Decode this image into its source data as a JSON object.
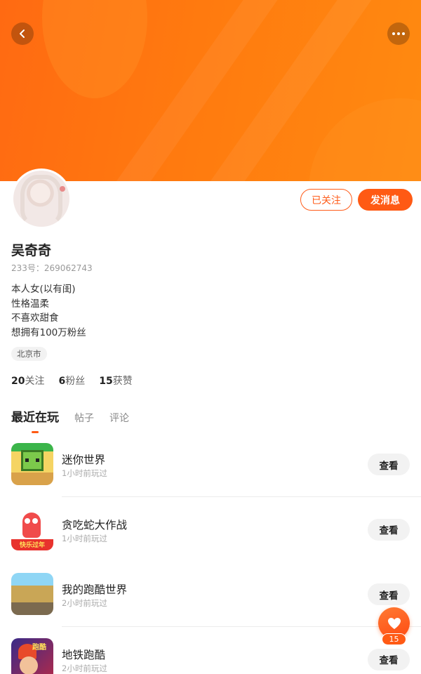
{
  "header": {
    "back_icon": "chevron-left-icon",
    "more_icon": "more-horizontal-icon",
    "cover_color": "#ff6a12"
  },
  "profile": {
    "name": "吴奇奇",
    "uid": "233号：269062743",
    "bio": [
      "本人女(以有闺)",
      "性格温柔",
      "不喜欢甜食",
      "想拥有100万粉丝"
    ],
    "location": "北京市",
    "stats": [
      {
        "value": "20",
        "label": "关注"
      },
      {
        "value": "6",
        "label": "粉丝"
      },
      {
        "value": "15",
        "label": "获赞"
      }
    ]
  },
  "actions": {
    "follow_label": "已关注",
    "message_label": "发消息",
    "accent_color": "#ff5a14"
  },
  "tabs": [
    {
      "label": "最近在玩",
      "active": true
    },
    {
      "label": "帖子",
      "active": false
    },
    {
      "label": "评论",
      "active": false
    }
  ],
  "games": [
    {
      "title": "迷你世界",
      "time": "1小时前玩过",
      "button": "查看"
    },
    {
      "title": "贪吃蛇大作战",
      "time": "1小时前玩过",
      "button": "查看",
      "banner": "快乐过年"
    },
    {
      "title": "我的跑酷世界",
      "time": "2小时前玩过",
      "button": "查看"
    },
    {
      "title": "地铁跑酷",
      "time": "2小时前玩过",
      "button": "查看",
      "logo": "跑酷"
    }
  ],
  "like": {
    "icon": "heart-icon",
    "count": "15"
  }
}
